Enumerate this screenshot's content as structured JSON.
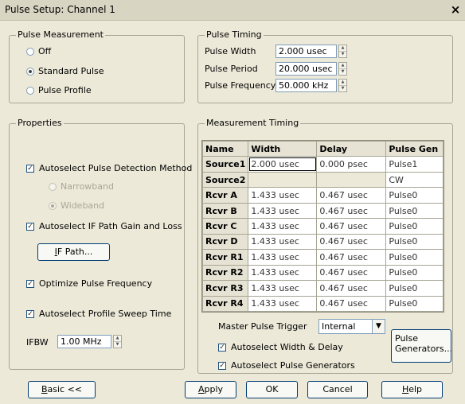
{
  "window": {
    "title": "Pulse Setup: Channel 1",
    "close_glyph": "×"
  },
  "pulse_measurement": {
    "label": "Pulse Measurement",
    "options": [
      "Off",
      "Standard Pulse",
      "Pulse Profile"
    ],
    "selected": "Standard Pulse"
  },
  "pulse_timing": {
    "label": "Pulse Timing",
    "width": {
      "label": "Pulse Width",
      "value": "2.000 usec"
    },
    "period": {
      "label": "Pulse Period",
      "value": "20.000 usec"
    },
    "frequency": {
      "label": "Pulse Frequency",
      "value": "50.000 kHz"
    }
  },
  "properties": {
    "label": "Properties",
    "autoselect_detection": {
      "label": "Autoselect Pulse Detection Method",
      "checked": true
    },
    "narrowband": {
      "label": "Narrowband",
      "selected": false
    },
    "wideband": {
      "label": "Wideband",
      "selected": true
    },
    "autoselect_if_gain": {
      "label": "Autoselect IF Path Gain and Loss",
      "checked": true
    },
    "if_path_button": {
      "accel": "I",
      "rest": "F Path..."
    },
    "optimize_frequency": {
      "label": "Optimize Pulse Frequency",
      "checked": true
    },
    "autoselect_sweep": {
      "label": "Autoselect Profile Sweep Time",
      "checked": true
    },
    "ifbw": {
      "label": "IFBW",
      "value": "1.00 MHz"
    }
  },
  "measurement_timing": {
    "label": "Measurement Timing",
    "columns": [
      "Name",
      "Width",
      "Delay",
      "Pulse Gen"
    ],
    "rows": [
      {
        "name": "Source1",
        "width": "2.000 usec",
        "delay": "0.000 psec",
        "gen": "Pulse1"
      },
      {
        "name": "Source2",
        "width": "",
        "delay": "",
        "gen": "CW"
      },
      {
        "name": "Rcvr A",
        "width": "1.433 usec",
        "delay": "0.467 usec",
        "gen": "Pulse0"
      },
      {
        "name": "Rcvr B",
        "width": "1.433 usec",
        "delay": "0.467 usec",
        "gen": "Pulse0"
      },
      {
        "name": "Rcvr C",
        "width": "1.433 usec",
        "delay": "0.467 usec",
        "gen": "Pulse0"
      },
      {
        "name": "Rcvr D",
        "width": "1.433 usec",
        "delay": "0.467 usec",
        "gen": "Pulse0"
      },
      {
        "name": "Rcvr R1",
        "width": "1.433 usec",
        "delay": "0.467 usec",
        "gen": "Pulse0"
      },
      {
        "name": "Rcvr R2",
        "width": "1.433 usec",
        "delay": "0.467 usec",
        "gen": "Pulse0"
      },
      {
        "name": "Rcvr R3",
        "width": "1.433 usec",
        "delay": "0.467 usec",
        "gen": "Pulse0"
      },
      {
        "name": "Rcvr R4",
        "width": "1.433 usec",
        "delay": "0.467 usec",
        "gen": "Pulse0"
      }
    ],
    "master_trigger": {
      "label": "Master Pulse Trigger",
      "value": "Internal"
    },
    "autoselect_width_delay": {
      "label": "Autoselect Width & Delay",
      "checked": true
    },
    "autoselect_generators": {
      "label": "Autoselect Pulse Generators",
      "checked": true
    },
    "pulse_generators_button": {
      "line1": "Pulse",
      "line2": "Generators..."
    }
  },
  "footer": {
    "basic": {
      "accel": "B",
      "rest": "asic <<"
    },
    "apply": {
      "accel": "A",
      "rest": "pply"
    },
    "ok": "OK",
    "cancel": "Cancel",
    "help": {
      "accel": "H",
      "rest": "elp"
    }
  }
}
